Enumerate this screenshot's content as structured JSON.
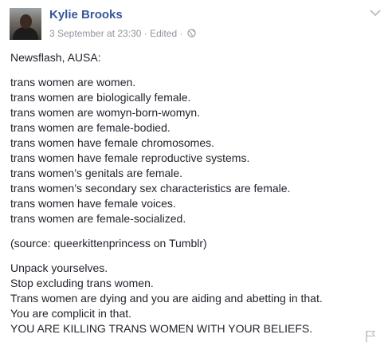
{
  "post": {
    "author": "Kylie Brooks",
    "timestamp": "3 September at 23:30",
    "separator": "·",
    "edited": "Edited",
    "separator2": "·",
    "privacy_icon": "globe-icon",
    "menu_icon": "chevron-down-icon",
    "report_icon": "flag-icon",
    "intro": "Newsflash, AUSA:",
    "list": [
      "trans women are women.",
      "trans women are biologically female.",
      "trans women are womyn-born-womyn.",
      "trans women are female-bodied.",
      "trans women have female chromosomes.",
      "trans women have female reproductive systems.",
      "trans women’s genitals are female.",
      "trans women’s secondary sex characteristics are female.",
      "trans women have female voices.",
      "trans women are female-socialized."
    ],
    "source": "(source: queerkittenprincess on Tumblr)",
    "closing": [
      "Unpack yourselves.",
      "Stop excluding trans women.",
      "Trans women are dying and you are aiding and abetting in that.",
      "You are complicit in that.",
      "YOU ARE KILLING TRANS WOMEN WITH YOUR BELIEFS."
    ],
    "colors": {
      "author_link": "#365899",
      "meta_text": "#90949c",
      "body_text": "#1d2129",
      "icon_gray": "#bec2c9"
    }
  }
}
